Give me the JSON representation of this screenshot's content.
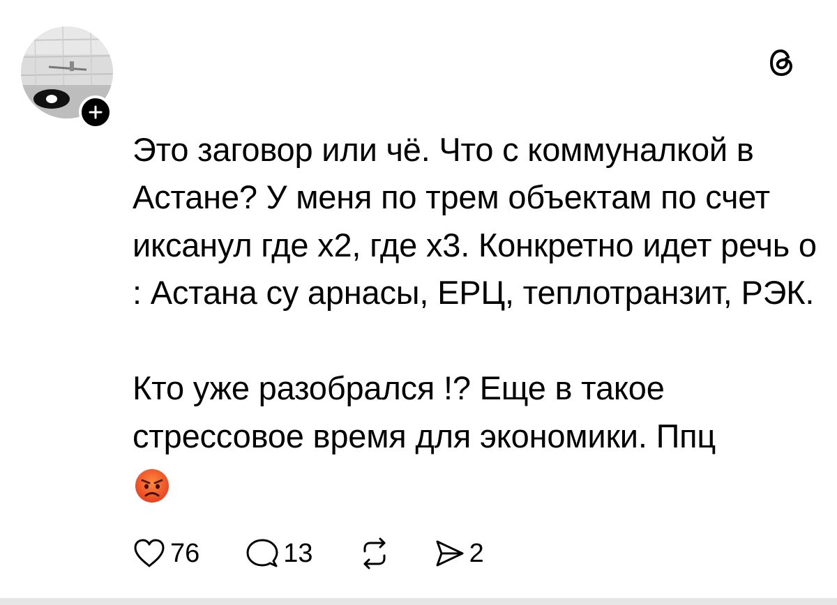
{
  "post": {
    "paragraphs": [
      "Это заговор или чё. Что с коммуналкой в Астане? У меня по трем объектам по счет иксанул где х2, где х3. Конкретно идет речь о : Астана су арнасы, ЕРЦ, теплотранзит, РЭК.",
      "Кто уже разобрался !? Еще в такое стрессовое время для экономики. Ппц"
    ],
    "emoji": "angry-face-emoji"
  },
  "actions": {
    "likes": "76",
    "replies": "13",
    "shares": "2"
  },
  "icons": {
    "brand": "threads-logo-icon",
    "follow": "plus-icon",
    "like": "heart-icon",
    "reply": "comment-icon",
    "repost": "repost-icon",
    "share": "send-icon"
  },
  "colors": {
    "text": "#000000",
    "background": "#ffffff",
    "emoji_face": "#f25a2a"
  }
}
